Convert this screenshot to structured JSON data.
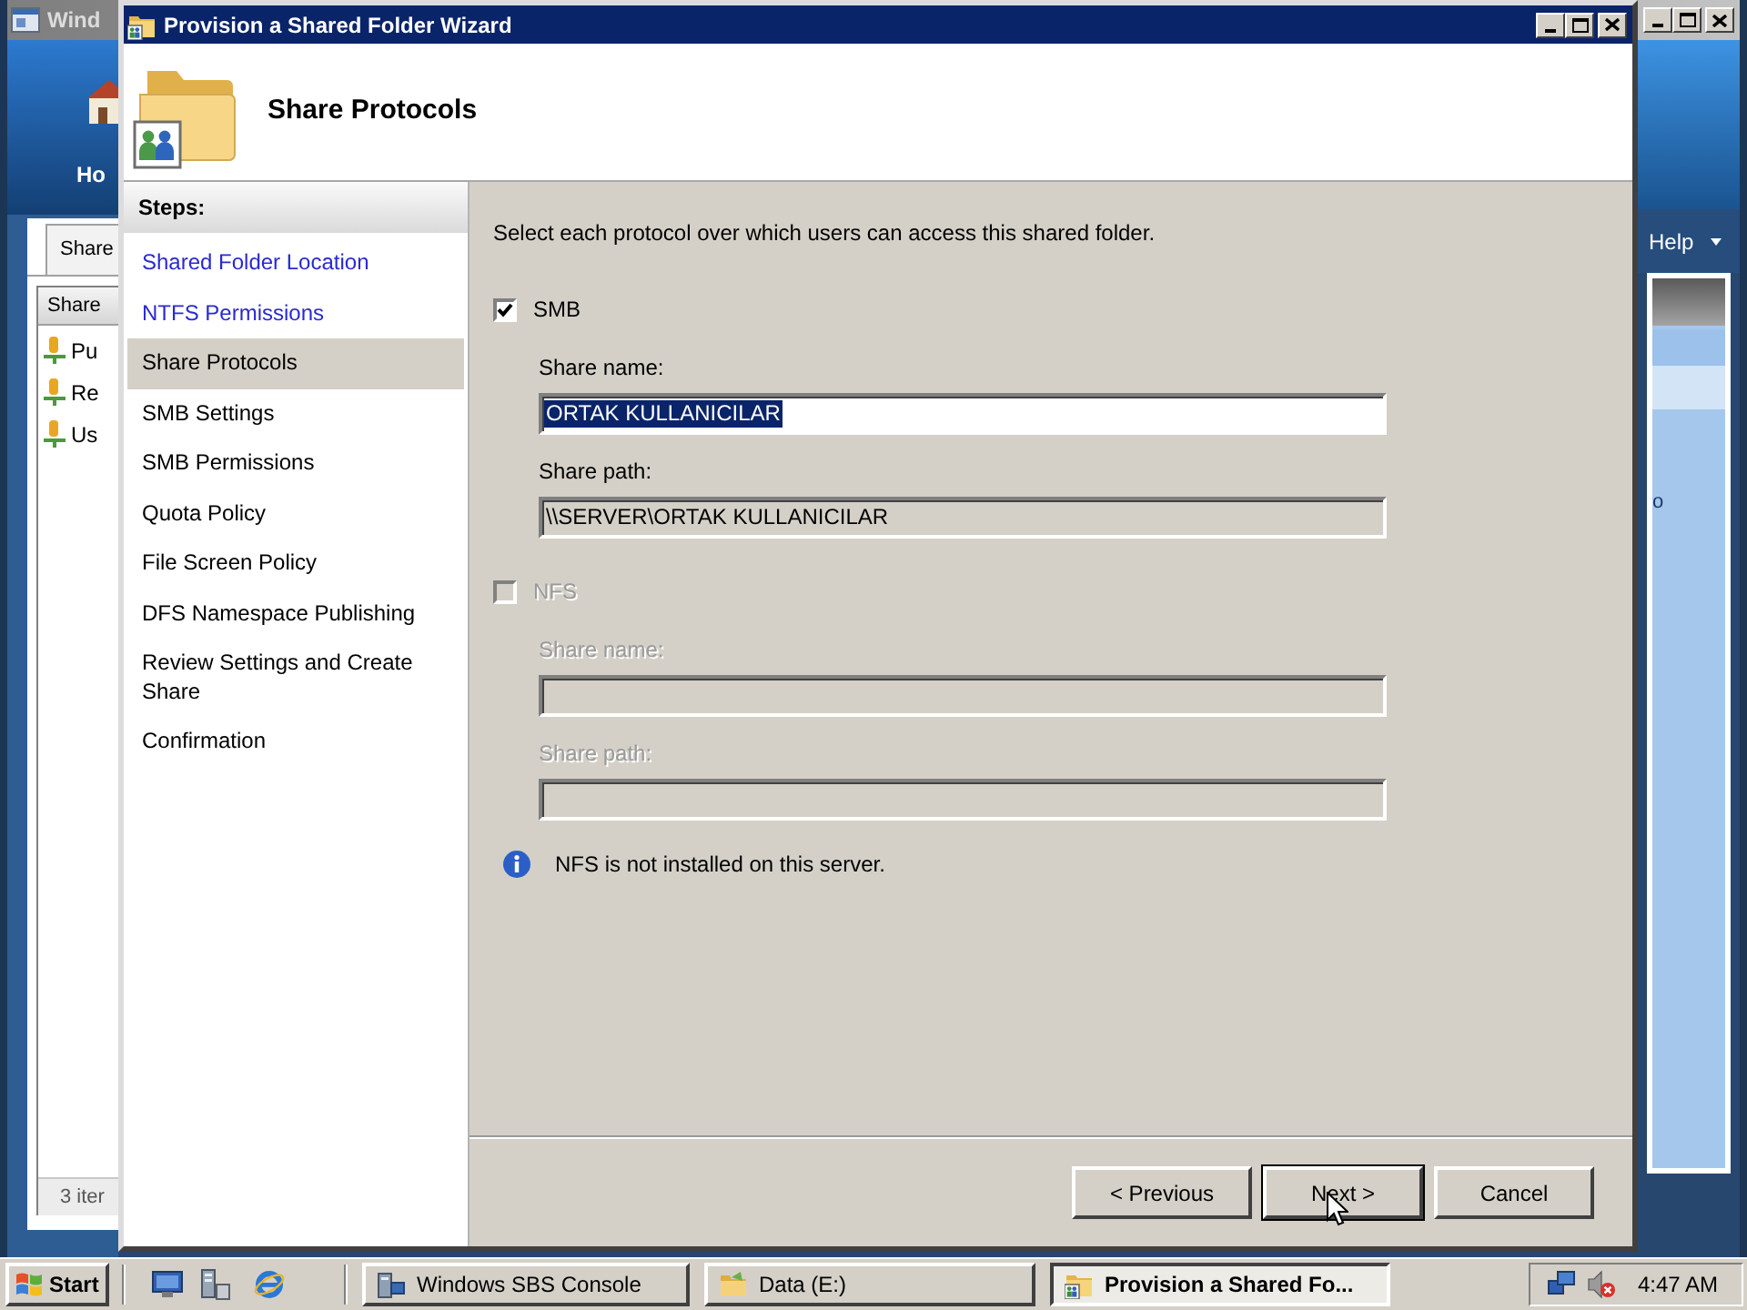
{
  "background_window": {
    "title": "Wind",
    "home_label": "Ho",
    "tab": "Share",
    "list": {
      "column": "Share",
      "items": [
        "Pu",
        "Re",
        "Us"
      ]
    },
    "status": "3 iter",
    "menu": "Help",
    "side_text": "o"
  },
  "wizard": {
    "title": "Provision a Shared Folder Wizard",
    "page_title": "Share Protocols",
    "steps_header": "Steps:",
    "steps": [
      {
        "label": "Shared Folder Location",
        "completed": true,
        "selected": false
      },
      {
        "label": "NTFS Permissions",
        "completed": true,
        "selected": false
      },
      {
        "label": "Share Protocols",
        "completed": false,
        "selected": true
      },
      {
        "label": "SMB Settings",
        "completed": false,
        "selected": false
      },
      {
        "label": "SMB Permissions",
        "completed": false,
        "selected": false
      },
      {
        "label": "Quota Policy",
        "completed": false,
        "selected": false
      },
      {
        "label": "File Screen Policy",
        "completed": false,
        "selected": false
      },
      {
        "label": "DFS Namespace Publishing",
        "completed": false,
        "selected": false
      },
      {
        "label": "Review Settings and Create Share",
        "completed": false,
        "selected": false
      },
      {
        "label": "Confirmation",
        "completed": false,
        "selected": false
      }
    ],
    "instruction": "Select each protocol over which users can access this shared folder.",
    "protocols": [
      {
        "label": "SMB",
        "checked": true,
        "disabled": false,
        "fields": [
          {
            "label": "Share name:",
            "value": "ORTAK KULLANICILAR",
            "readonly": false,
            "text_selected": true
          },
          {
            "label": "Share path:",
            "value": "\\\\SERVER\\ORTAK KULLANICILAR",
            "readonly": true,
            "text_selected": false
          }
        ]
      },
      {
        "label": "NFS",
        "checked": false,
        "disabled": true,
        "fields": [
          {
            "label": "Share name:"
          },
          {
            "label": "Share path:"
          }
        ]
      }
    ],
    "info": "NFS is not installed on this server.",
    "buttons": [
      {
        "label": "< Previous",
        "default": false
      },
      {
        "label": "Next >",
        "default": true
      },
      {
        "label": "Cancel",
        "default": false
      }
    ]
  },
  "taskbar": {
    "start": "Start",
    "tasks": [
      {
        "label": "Windows SBS Console",
        "active": false
      },
      {
        "label": "Data (E:)",
        "active": false
      },
      {
        "label": "Provision a Shared Fo...",
        "active": true
      }
    ],
    "clock": "4:47 AM"
  }
}
